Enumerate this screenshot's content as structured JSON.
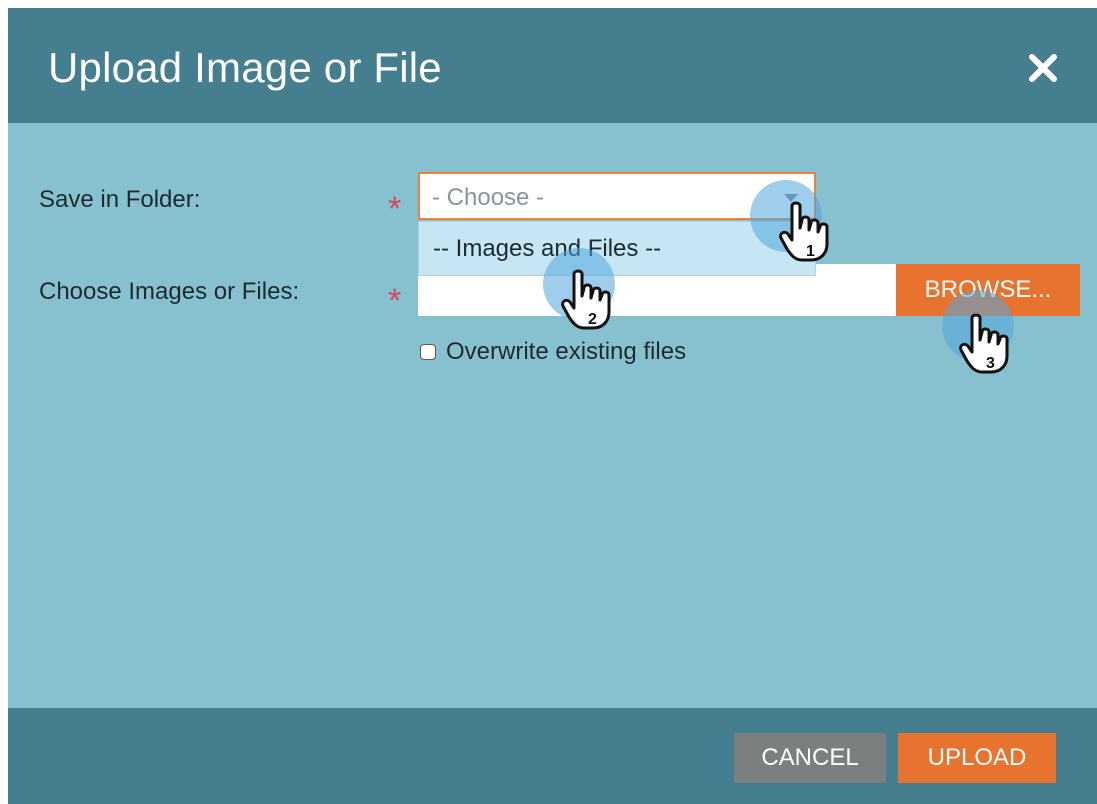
{
  "dialog": {
    "title": "Upload Image or File",
    "close_icon": "close-icon"
  },
  "form": {
    "folder_label": "Save in Folder:",
    "folder_required_mark": "*",
    "folder_select_value": "- Choose -",
    "folder_dropdown_option": "-- Images and Files --",
    "files_label": "Choose Images or Files:",
    "files_required_mark": "*",
    "files_input_value": "",
    "browse_label": "BROWSE...",
    "overwrite_label": "Overwrite existing files",
    "overwrite_checked": false
  },
  "footer": {
    "cancel_label": "CANCEL",
    "upload_label": "UPLOAD"
  },
  "annotations": {
    "step1": "1",
    "step2": "2",
    "step3": "3"
  },
  "colors": {
    "header": "#457e8e",
    "body": "#87c1cf",
    "accent": "#e8732e",
    "cancel": "#7b7f80",
    "required": "#d9475a",
    "highlight": "#c6e6f4"
  }
}
